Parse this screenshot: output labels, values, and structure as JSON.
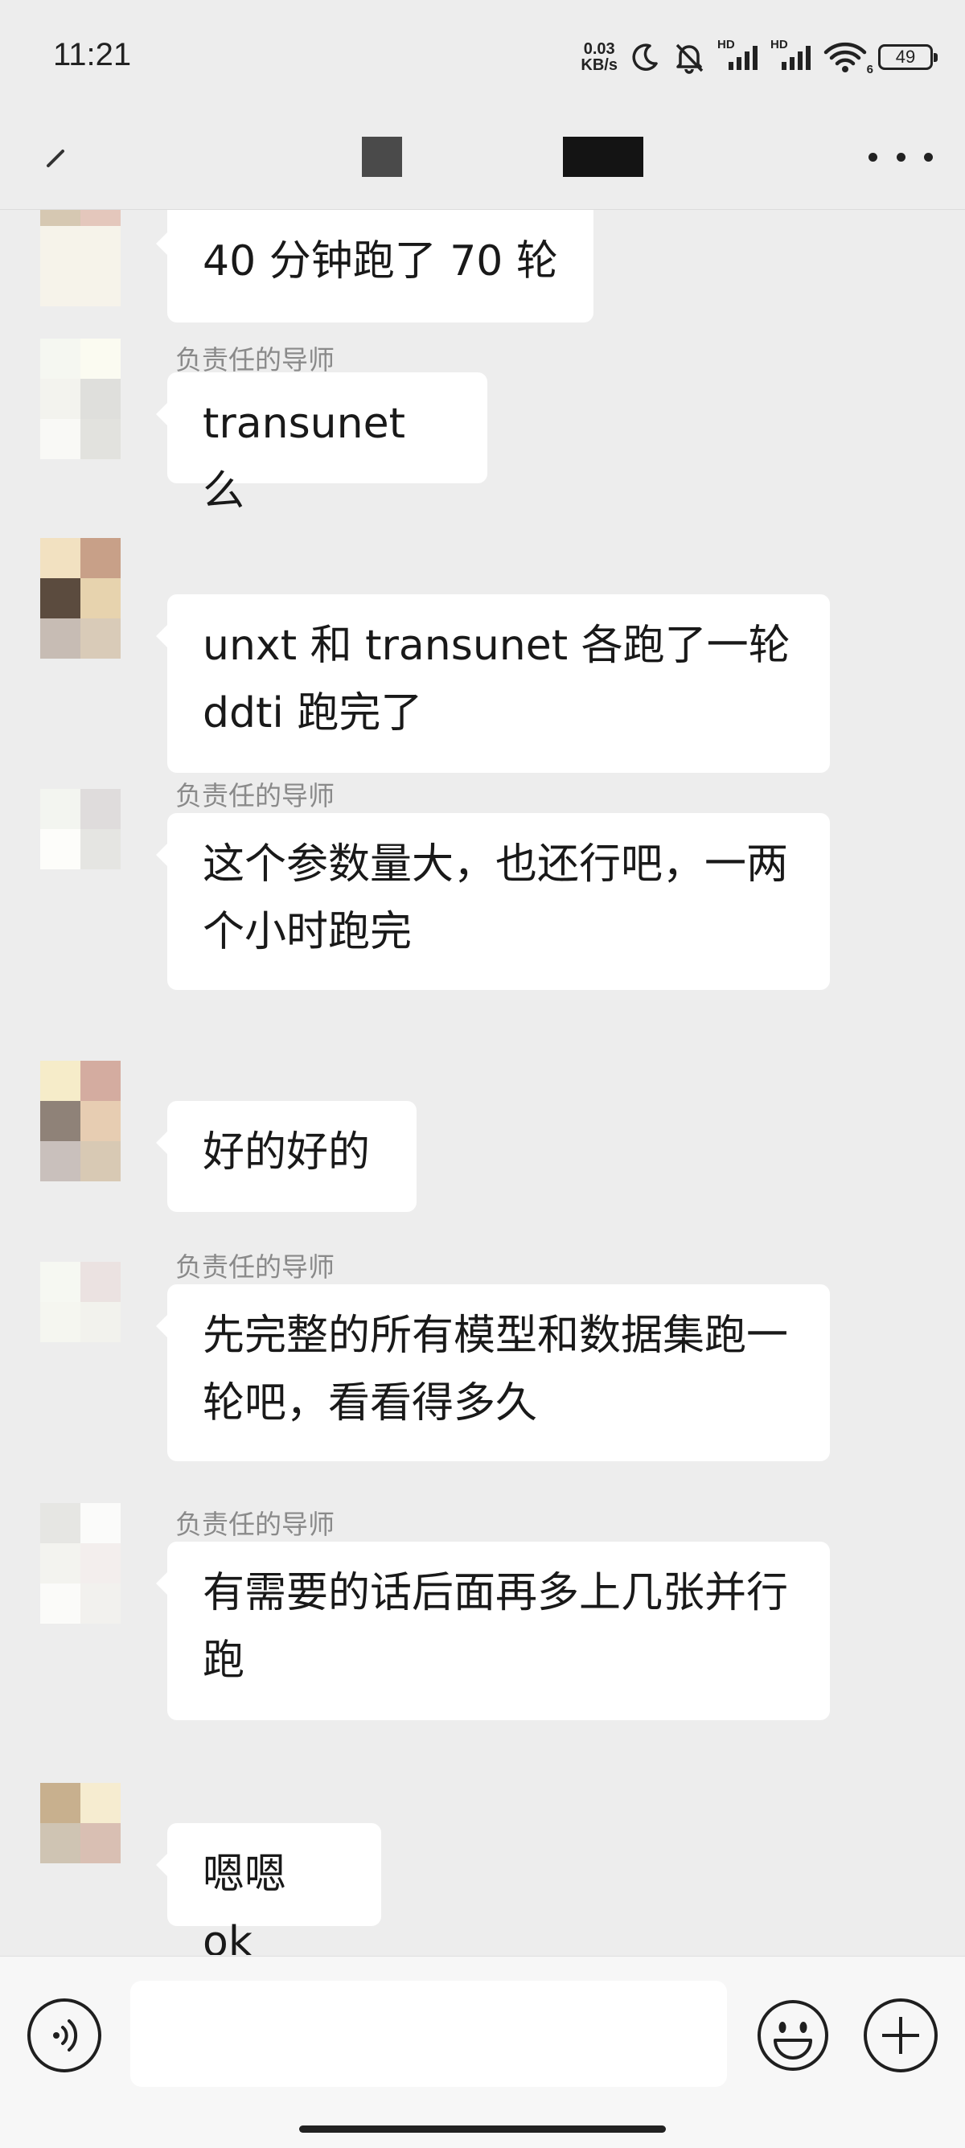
{
  "status_bar": {
    "time": "11:21",
    "net_speed_value": "0.03",
    "net_speed_unit": "KB/s",
    "hd_label_1": "HD",
    "hd_label_2": "HD",
    "wifi_label": "6",
    "battery": "49"
  },
  "header": {
    "back_icon": "back-arrow-icon",
    "more_icon": "more-icon"
  },
  "messages": [
    {
      "sender": "",
      "text": "40 分钟跑了 70 轮",
      "avatar": [
        "#d6c8b2",
        "#e4c7bc",
        "#f6f3ea",
        "#f6f3ea",
        "#f6f3ea",
        "#f6f3ea"
      ]
    },
    {
      "sender": "负责任的导师",
      "text": "transunet 么",
      "avatar": [
        "#f5f7f1",
        "#fbfbf1",
        "#f3f3ee",
        "#dfdfdc",
        "#f9f9f6",
        "#e2e2de"
      ]
    },
    {
      "sender": "",
      "text": "unxt 和 transunet 各跑了一轮\nddti 跑完了",
      "avatar": [
        "#f2e1c1",
        "#c8a088",
        "#5b4b3e",
        "#e7d3ae",
        "#c7bcb4",
        "#d9cbb8"
      ]
    },
    {
      "sender": "负责任的导师",
      "text": "这个参数量大，也还行吧，一两个小时跑完",
      "avatar": [
        "#f3f5f0",
        "#dfdcdc",
        "#fdfdfa",
        "#e5e5e2",
        "#ededed",
        "#ededed"
      ]
    },
    {
      "sender": "",
      "text": "好的好的",
      "avatar": [
        "#f6ecc9",
        "#d4aca0",
        "#8f8278",
        "#e7cdb2",
        "#c9c0bc",
        "#d8c9b4"
      ]
    },
    {
      "sender": "负责任的导师",
      "text": "先完整的所有模型和数据集跑一轮吧，看看得多久",
      "avatar": [
        "#f6f8f2",
        "#ebe2e1",
        "#f5f6f0",
        "#f2f2ed",
        "#ededed",
        "#ededed"
      ]
    },
    {
      "sender": "负责任的导师",
      "text": "有需要的话后面再多上几张并行跑",
      "avatar": [
        "#e6e6e3",
        "#fbfbfa",
        "#f3f3ef",
        "#f3eeed",
        "#fbfbf9",
        "#f2f1ee"
      ]
    },
    {
      "sender": "",
      "text": "嗯嗯 ok",
      "avatar": [
        "#c8b08e",
        "#f6ecd0",
        "#cfc4b3",
        "#d9bfb3",
        "#ededed",
        "#ededed"
      ]
    }
  ],
  "input": {
    "placeholder": "",
    "voice_icon": "voice-icon",
    "emoji_icon": "emoji-icon",
    "plus_icon": "plus-icon"
  }
}
